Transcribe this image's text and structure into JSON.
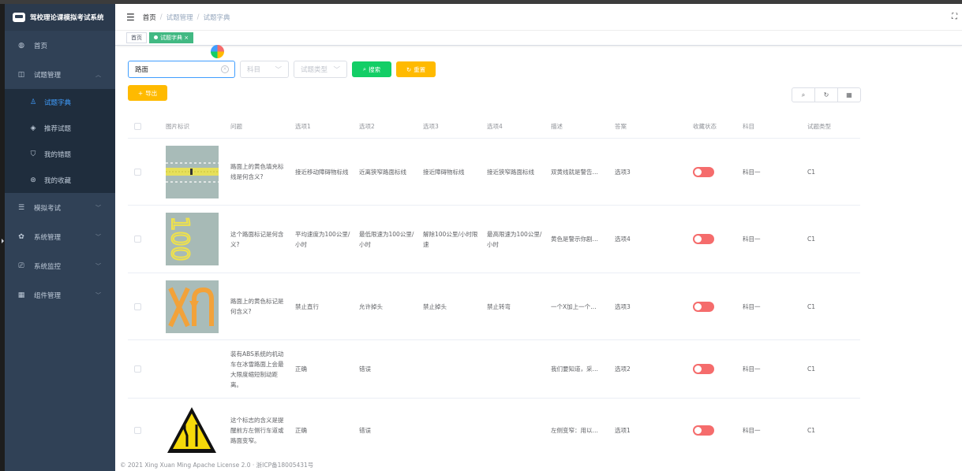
{
  "app": {
    "title": "驾校理论课模拟考试系统"
  },
  "sidebar": {
    "items": [
      {
        "label": "首页",
        "icon": "dashboard-icon"
      },
      {
        "label": "试题管理",
        "icon": "window-icon",
        "expanded": true
      },
      {
        "label": "模拟考试",
        "icon": "list-icon"
      },
      {
        "label": "系统管理",
        "icon": "gear-icon"
      },
      {
        "label": "系统监控",
        "icon": "monitor-icon"
      },
      {
        "label": "组件管理",
        "icon": "grid-icon"
      }
    ],
    "subitems": [
      {
        "label": "试题字典",
        "icon": "user-icon",
        "active": true
      },
      {
        "label": "推荐试题",
        "icon": "eye-icon"
      },
      {
        "label": "我的错题",
        "icon": "shield-icon"
      },
      {
        "label": "我的收藏",
        "icon": "compass-icon"
      }
    ]
  },
  "navbar": {
    "breadcrumb": [
      "首页",
      "试题管理",
      "试题字典"
    ],
    "separator": "/"
  },
  "tags": [
    {
      "label": "首页",
      "active": false
    },
    {
      "label": "试题字典",
      "active": true,
      "close": "×"
    }
  ],
  "search": {
    "keyword": "路面",
    "subject_placeholder": "科目",
    "type_placeholder": "试题类型",
    "search_label": "搜索",
    "reset_label": "重置"
  },
  "toolbar": {
    "export_label": "导出"
  },
  "table": {
    "headers": [
      "图片标识",
      "问题",
      "选项1",
      "选项2",
      "选项3",
      "选项4",
      "描述",
      "答案",
      "收藏状态",
      "科目",
      "试题类型"
    ],
    "rows": [
      {
        "image": "yellow-fill-marking",
        "question": "路面上的黄色填充标线是何含义?",
        "opt1": "接近移动障碍物标线",
        "opt2": "近离狭窄路面标线",
        "opt3": "接近障碍物标线",
        "opt4": "接近狭窄路面标线",
        "desc": "双黄线就是警告…",
        "answer": "选项3",
        "fav": true,
        "subject": "科目一",
        "type": "C1"
      },
      {
        "image": "speed-100-marking",
        "question": "这个路面标记是何含义?",
        "opt1": "平均速度为100公里/小时",
        "opt2": "最低限速为100公里/小时",
        "opt3": "解除100公里/小时限速",
        "opt4": "最高限速为100公里/小时",
        "desc": "黄色是警示你剧…",
        "answer": "选项4",
        "fav": true,
        "subject": "科目一",
        "type": "C1"
      },
      {
        "image": "no-uturn-marking",
        "question": "路面上的黄色标记是何含义?",
        "opt1": "禁止直行",
        "opt2": "允许掉头",
        "opt3": "禁止掉头",
        "opt4": "禁止转弯",
        "desc": "一个X加上一个…",
        "answer": "选项3",
        "fav": true,
        "subject": "科目一",
        "type": "C1"
      },
      {
        "image": "",
        "question": "装有ABS系统的机动车在冰雪路面上会最大限度缩短制动距离。",
        "opt1": "正确",
        "opt2": "错误",
        "opt3": "",
        "opt4": "",
        "desc": "我们要知道，采…",
        "answer": "选项2",
        "fav": true,
        "subject": "科目一",
        "type": "C1"
      },
      {
        "image": "lane-narrow-sign",
        "question": "这个标志的含义是提醒前方左侧行车道或路面变窄。",
        "opt1": "正确",
        "opt2": "错误",
        "opt3": "",
        "opt4": "",
        "desc": "左侧变窄：用以…",
        "answer": "选项1",
        "fav": true,
        "subject": "科目一",
        "type": "C1"
      }
    ]
  },
  "footer": {
    "text": "© 2021 Xing Xuan Ming Apache License 2.0 · 浙ICP备18005431号"
  },
  "colors": {
    "sidebar": "#304156",
    "active": "#409eff",
    "tag_active": "#42b983",
    "search_btn": "#13ce66",
    "reset_btn": "#ffba00",
    "switch_on": "#f56c6c"
  }
}
